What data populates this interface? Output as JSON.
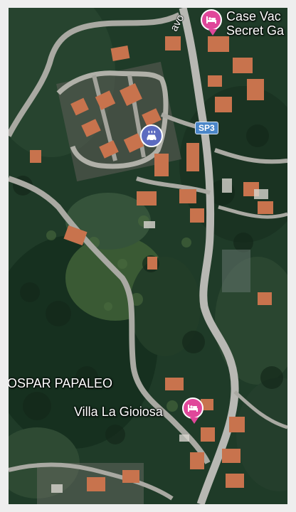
{
  "map": {
    "type": "satellite",
    "colors": {
      "pin": "#e0479a",
      "poi": "#5c6bc0",
      "shield": "#4a86c8",
      "road": "#bdbdbd"
    },
    "places": {
      "top_right_line1": "Case Vac",
      "top_right_line2": "Secret Ga",
      "villa": "Villa La Gioiosa",
      "left_label": "OSPAR PAPALEO"
    },
    "road_shield": "SP3",
    "road_fragment": "avo",
    "icons": {
      "lodging_pin": "lodging-pin-icon",
      "car_wash_poi": "car-wash-icon"
    }
  }
}
